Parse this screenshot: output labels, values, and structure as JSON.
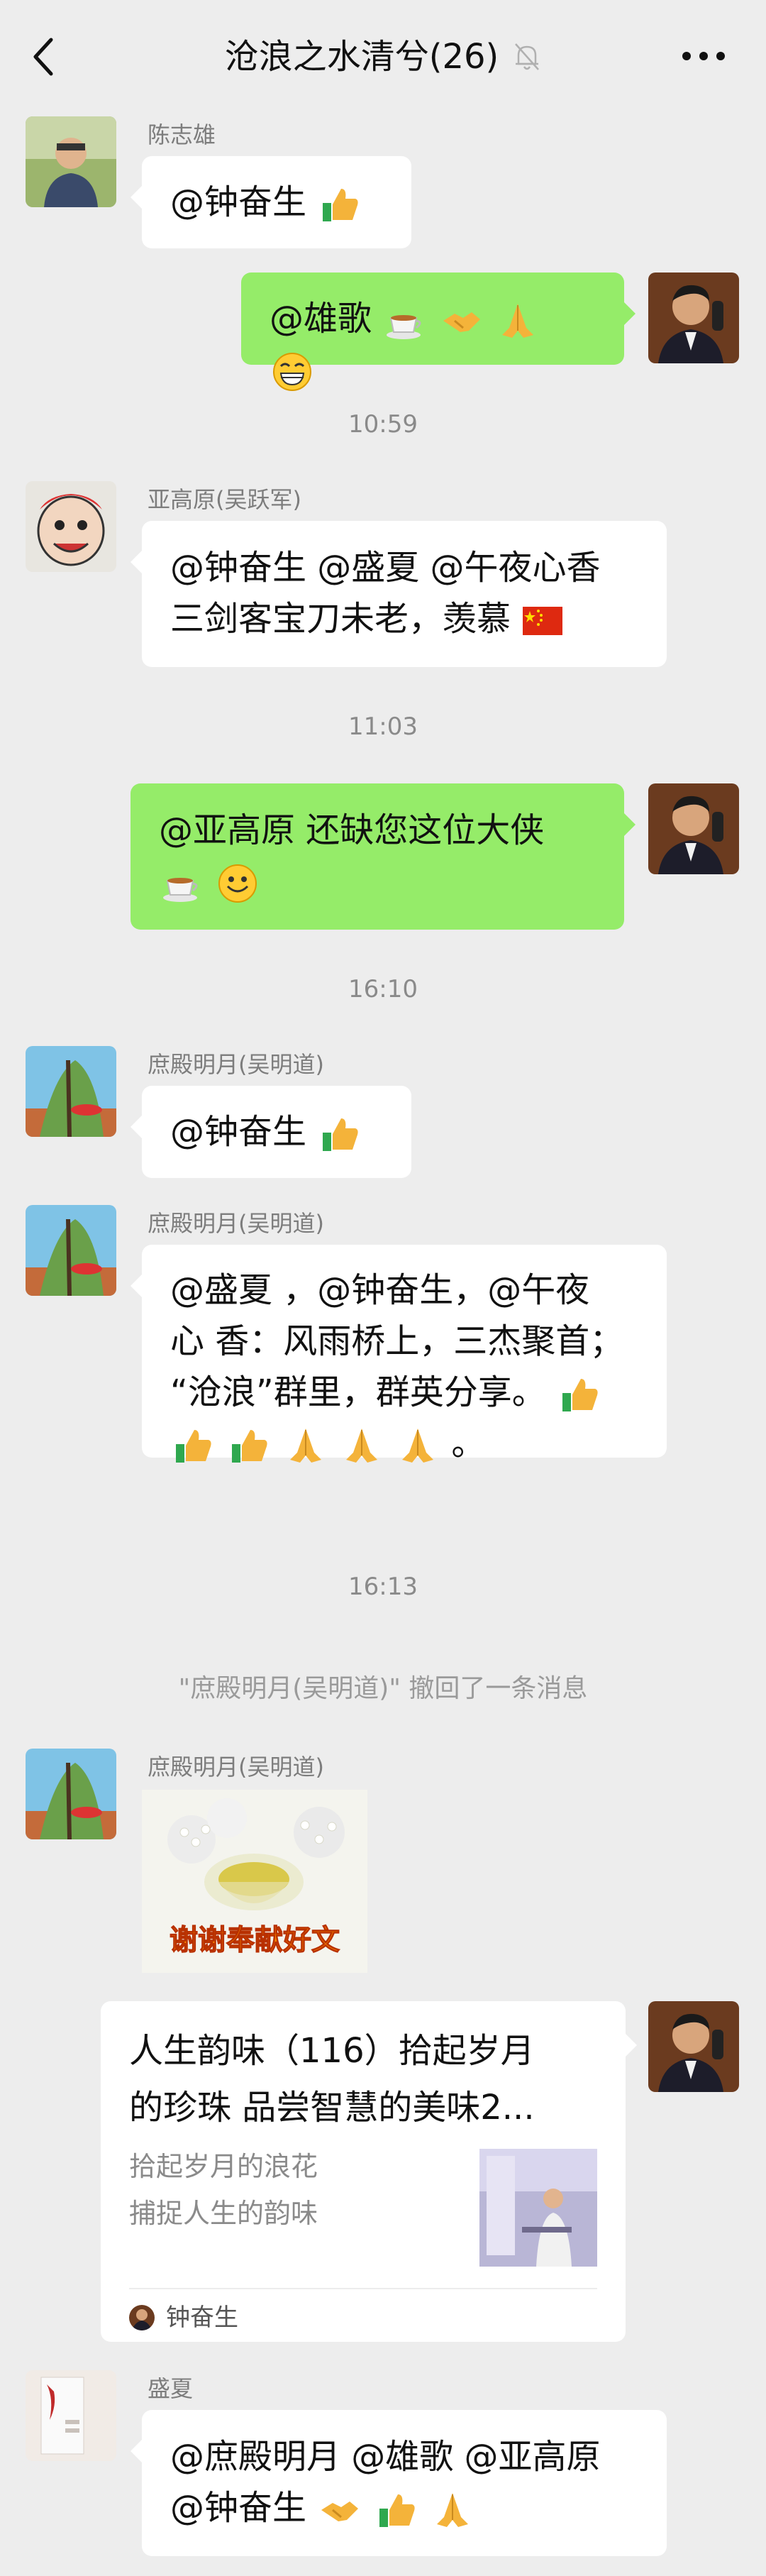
{
  "header": {
    "title": "沧浪之水清兮(26)",
    "back_icon": "chevron-left-icon",
    "mute_icon": "bell-muted-icon",
    "more_icon": "more-dots-icon"
  },
  "messages": [
    {
      "sender": "陈志雄",
      "text": "@钟奋生 ",
      "emoji": "thumbs-up"
    },
    {
      "self": true,
      "text": "@雄歌 ",
      "emoji": "tea, handshake, pray, grin"
    },
    {
      "time": "10:59"
    },
    {
      "sender": "亚高原(吴跃军)",
      "line1": "@钟奋生 @盛夏 @午夜心香",
      "line2": "三剑客宝刀未老，羡慕",
      "emoji": "china-flag"
    },
    {
      "time": "11:03"
    },
    {
      "self": true,
      "line1": "@亚高原  还缺您这位大侠",
      "emoji": "tea, smile"
    },
    {
      "time": "16:10"
    },
    {
      "sender": "庶殿明月(吴明道)",
      "text": "@钟奋生 ",
      "emoji": "thumbs-up"
    },
    {
      "sender": "庶殿明月(吴明道)",
      "line1": "@盛夏 ，@钟奋生，@午夜",
      "line2": "心  香：风雨桥上，三杰聚首；",
      "line3": "“沧浪”群里，群英分享。",
      "line4": "。"
    },
    {
      "time": "16:13"
    },
    {
      "notice": "\"庶殿明月(吴明道)\" 撤回了一条消息"
    },
    {
      "sender": "庶殿明月(吴明道)",
      "image_caption": "谢谢奉献好文"
    },
    {
      "self": true,
      "card": {
        "title_line1": "人生韵味（116）拾起岁月",
        "title_line2": "的珍珠 品尝智慧的美味2...",
        "desc_line1": "拾起岁月的浪花",
        "desc_line2": "捕捉人生的韵味",
        "source": "钟奋生"
      }
    },
    {
      "sender": "盛夏",
      "line1": "@庶殿明月 @雄歌 @亚高原",
      "line2": "@钟奋生 "
    }
  ],
  "colors": {
    "background": "#ededed",
    "bubble_self": "#95ec69",
    "bubble_other": "#ffffff",
    "sender_name": "#7d7d7d",
    "timestamp": "#8a8a8a"
  }
}
